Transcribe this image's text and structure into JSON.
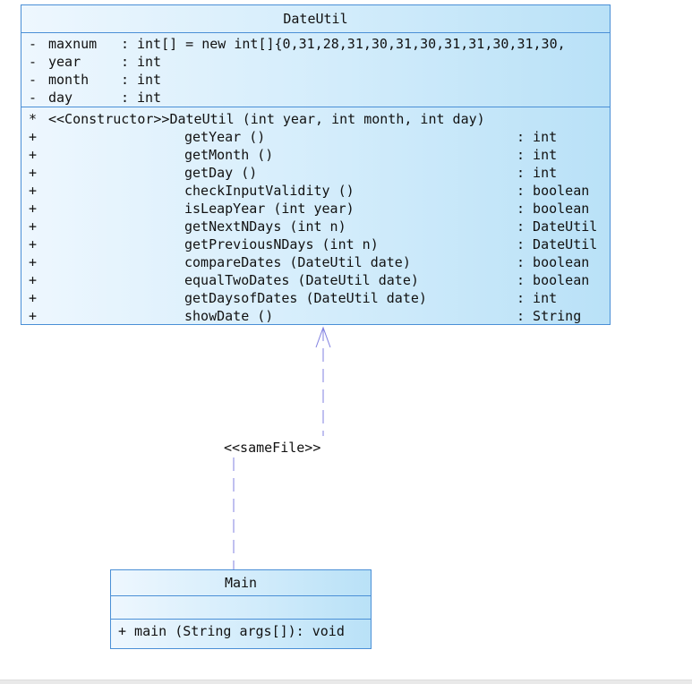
{
  "diagram": {
    "classes": {
      "dateutil": {
        "name": "DateUtil",
        "attributes": [
          {
            "visibility": "-",
            "name": "maxnum",
            "sep": ":",
            "type": "int[]  = new int[]{0,31,28,31,30,31,30,31,31,30,31,30,"
          },
          {
            "visibility": "-",
            "name": "year",
            "sep": ":",
            "type": "int"
          },
          {
            "visibility": "-",
            "name": "month",
            "sep": ":",
            "type": "int"
          },
          {
            "visibility": "-",
            "name": "day",
            "sep": ":",
            "type": "int"
          }
        ],
        "operations": [
          {
            "visibility": "*",
            "signature": "<<Constructor>>DateUtil (int year, int month, int day)",
            "ret": ""
          },
          {
            "visibility": "+",
            "signature": "getYear ()",
            "ret": ": int"
          },
          {
            "visibility": "+",
            "signature": "getMonth ()",
            "ret": ": int"
          },
          {
            "visibility": "+",
            "signature": "getDay ()",
            "ret": ": int"
          },
          {
            "visibility": "+",
            "signature": "checkInputValidity ()",
            "ret": ": boolean"
          },
          {
            "visibility": "+",
            "signature": "isLeapYear (int year)",
            "ret": ": boolean"
          },
          {
            "visibility": "+",
            "signature": "getNextNDays (int n)",
            "ret": ": DateUtil"
          },
          {
            "visibility": "+",
            "signature": "getPreviousNDays (int n)",
            "ret": ": DateUtil"
          },
          {
            "visibility": "+",
            "signature": "compareDates (DateUtil date)",
            "ret": ": boolean"
          },
          {
            "visibility": "+",
            "signature": "equalTwoDates (DateUtil date)",
            "ret": ": boolean"
          },
          {
            "visibility": "+",
            "signature": "getDaysofDates (DateUtil date)",
            "ret": ": int"
          },
          {
            "visibility": "+",
            "signature": "showDate ()",
            "ret": ": String"
          }
        ]
      },
      "main": {
        "name": "Main",
        "operations": [
          {
            "text": "+ main (String args[]): void"
          }
        ]
      }
    },
    "relation": {
      "stereotype": "<<sameFile>>",
      "color": "#8080e0"
    },
    "colors": {
      "border": "#4a8fd6",
      "fill_light": "#eef7fe",
      "fill_dark": "#b9e1f7"
    }
  }
}
